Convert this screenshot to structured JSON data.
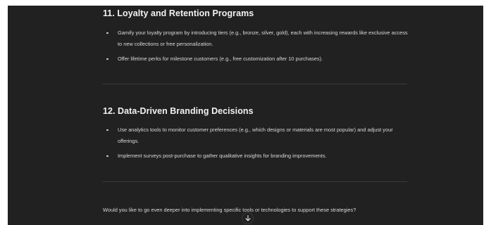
{
  "sections": [
    {
      "title": "11. Loyalty and Retention Programs",
      "bullets": [
        "Gamify your loyalty program by introducing tiers (e.g., bronze, silver, gold), each with increasing rewards like exclusive access to new collections or free personalization.",
        "Offer lifetime perks for milestone customers (e.g., free customization after 10 purchases)."
      ]
    },
    {
      "title": "12. Data-Driven Branding Decisions",
      "bullets": [
        "Use analytics tools to monitor customer preferences (e.g., which designs or materials are most popular) and adjust your offerings.",
        "Implement surveys post-purchase to gather qualitative insights for branding improvements."
      ]
    }
  ],
  "closing_question": "Would you like to go even deeper into implementing specific tools or technologies to support these strategies?",
  "scroll_button": {
    "icon": "arrow-down-icon"
  },
  "colors": {
    "background": "#212121",
    "text": "#ececec",
    "divider": "#3c3c3c"
  }
}
